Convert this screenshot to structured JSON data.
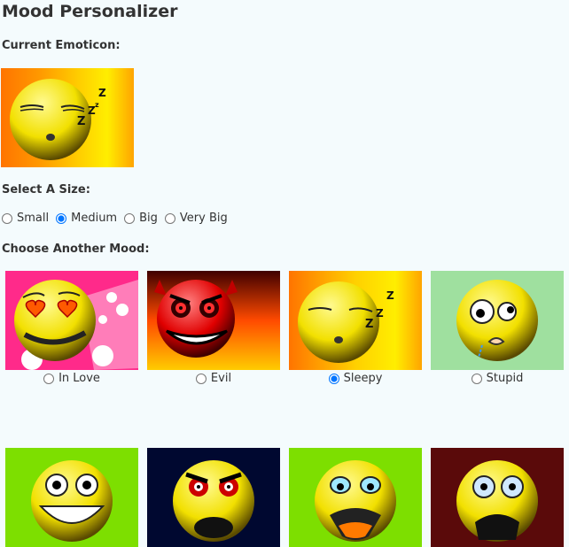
{
  "page": {
    "title": "Mood Personalizer",
    "current_label": "Current Emoticon:",
    "size_label": "Select A Size:",
    "mood_label": "Choose Another Mood:"
  },
  "current_emoticon": {
    "mood": "Sleepy",
    "icon": "sleepy-face-icon"
  },
  "sizes": {
    "options": [
      "Small",
      "Medium",
      "Big",
      "Very Big"
    ],
    "selected": "Medium"
  },
  "moods": [
    {
      "label": "In Love",
      "icon": "in-love-face-icon",
      "bg": "#ff2a8a",
      "selected": false
    },
    {
      "label": "Evil",
      "icon": "evil-face-icon",
      "bg": "#c01800",
      "selected": false
    },
    {
      "label": "Sleepy",
      "icon": "sleepy-face-icon",
      "bg": "#ff9a00",
      "selected": true
    },
    {
      "label": "Stupid",
      "icon": "stupid-face-icon",
      "bg": "#9fe09f",
      "selected": false
    },
    {
      "icon": "grinning-face-icon",
      "bg": "#7ddf00"
    },
    {
      "icon": "angry-face-icon",
      "bg": "#000830"
    },
    {
      "icon": "shocked-face-icon",
      "bg": "#7ddf00"
    },
    {
      "icon": "scared-face-icon",
      "bg": "#5a0a0a"
    }
  ],
  "colors": {
    "background": "#f4fbfd",
    "smiley": "#f5e400"
  }
}
